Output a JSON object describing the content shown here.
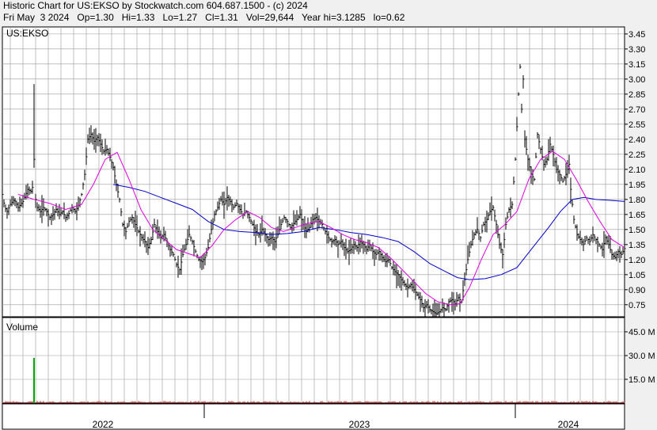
{
  "header": {
    "line1": "Historic Chart for US:EKSO by Stockwatch.com 604.687.1500 - (c) 2024",
    "line2": "Fri May  3 2024   Op=1.30   Hi=1.33   Lo=1.27   Cl=1.31   Vol=29,644   Year hi=3.1285   lo=0.62"
  },
  "chart_data": {
    "type": "line",
    "symbol": "US:EKSO",
    "volume_label": "Volume",
    "price_axis": {
      "ticks": [
        3.45,
        3.3,
        3.15,
        3.0,
        2.85,
        2.7,
        2.55,
        2.4,
        2.25,
        2.1,
        1.95,
        1.8,
        1.65,
        1.5,
        1.35,
        1.2,
        1.05,
        0.9,
        0.75
      ],
      "range": [
        0.63,
        3.52
      ]
    },
    "volume_axis": {
      "ticks": [
        "45.0 M",
        "30.0 M",
        "15.0 M"
      ],
      "tick_values": [
        45,
        30,
        15
      ],
      "range": [
        0,
        54
      ]
    },
    "x_labels": [
      "2022",
      "2023",
      "2024"
    ],
    "colors": {
      "price_bars": "#000000",
      "ma_short": "#e000e0",
      "ma_long": "#0000cc",
      "volume_bars": "#b00000",
      "volume_spike": "#00aa00",
      "grid": "#9a9a9a",
      "background": "#ffffff"
    },
    "series": [
      {
        "key": "price_close",
        "points": [
          [
            0,
            1.85
          ],
          [
            3,
            1.72
          ],
          [
            6,
            1.68
          ],
          [
            10,
            1.75
          ],
          [
            15,
            1.8
          ],
          [
            20,
            1.72
          ],
          [
            26,
            1.78
          ],
          [
            32,
            1.9
          ],
          [
            36,
            1.88
          ],
          [
            38,
            1.92
          ],
          [
            40,
            2.2
          ],
          [
            42,
            1.8
          ],
          [
            44,
            1.72
          ],
          [
            48,
            1.68
          ],
          [
            52,
            1.72
          ],
          [
            56,
            1.68
          ],
          [
            60,
            1.62
          ],
          [
            64,
            1.65
          ],
          [
            68,
            1.7
          ],
          [
            72,
            1.65
          ],
          [
            76,
            1.68
          ],
          [
            80,
            1.62
          ],
          [
            84,
            1.66
          ],
          [
            88,
            1.72
          ],
          [
            92,
            1.68
          ],
          [
            96,
            1.74
          ],
          [
            100,
            1.85
          ],
          [
            104,
            2.05
          ],
          [
            108,
            2.4
          ],
          [
            112,
            2.45
          ],
          [
            116,
            2.38
          ],
          [
            120,
            2.42
          ],
          [
            124,
            2.35
          ],
          [
            128,
            2.28
          ],
          [
            132,
            2.3
          ],
          [
            136,
            2.22
          ],
          [
            140,
            2.12
          ],
          [
            144,
            1.95
          ],
          [
            148,
            1.8
          ],
          [
            152,
            1.55
          ],
          [
            156,
            1.48
          ],
          [
            160,
            1.58
          ],
          [
            164,
            1.62
          ],
          [
            168,
            1.55
          ],
          [
            172,
            1.48
          ],
          [
            176,
            1.42
          ],
          [
            180,
            1.38
          ],
          [
            184,
            1.32
          ],
          [
            188,
            1.4
          ],
          [
            192,
            1.55
          ],
          [
            196,
            1.48
          ],
          [
            200,
            1.42
          ],
          [
            204,
            1.45
          ],
          [
            208,
            1.38
          ],
          [
            212,
            1.3
          ],
          [
            216,
            1.25
          ],
          [
            220,
            1.15
          ],
          [
            224,
            1.1
          ],
          [
            228,
            1.25
          ],
          [
            232,
            1.35
          ],
          [
            236,
            1.45
          ],
          [
            240,
            1.38
          ],
          [
            244,
            1.28
          ],
          [
            248,
            1.2
          ],
          [
            252,
            1.18
          ],
          [
            256,
            1.22
          ],
          [
            260,
            1.32
          ],
          [
            264,
            1.5
          ],
          [
            268,
            1.65
          ],
          [
            272,
            1.72
          ],
          [
            276,
            1.8
          ],
          [
            280,
            1.75
          ],
          [
            284,
            1.82
          ],
          [
            288,
            1.78
          ],
          [
            292,
            1.72
          ],
          [
            296,
            1.76
          ],
          [
            300,
            1.7
          ],
          [
            304,
            1.65
          ],
          [
            308,
            1.68
          ],
          [
            312,
            1.62
          ],
          [
            316,
            1.55
          ],
          [
            320,
            1.48
          ],
          [
            324,
            1.45
          ],
          [
            328,
            1.5
          ],
          [
            332,
            1.45
          ],
          [
            336,
            1.4
          ],
          [
            340,
            1.42
          ],
          [
            344,
            1.38
          ],
          [
            348,
            1.45
          ],
          [
            352,
            1.55
          ],
          [
            356,
            1.62
          ],
          [
            360,
            1.58
          ],
          [
            364,
            1.52
          ],
          [
            368,
            1.56
          ],
          [
            372,
            1.6
          ],
          [
            376,
            1.65
          ],
          [
            380,
            1.55
          ],
          [
            384,
            1.48
          ],
          [
            388,
            1.52
          ],
          [
            392,
            1.6
          ],
          [
            396,
            1.62
          ],
          [
            400,
            1.58
          ],
          [
            404,
            1.55
          ],
          [
            408,
            1.48
          ],
          [
            412,
            1.42
          ],
          [
            416,
            1.38
          ],
          [
            420,
            1.4
          ],
          [
            424,
            1.35
          ],
          [
            428,
            1.38
          ],
          [
            432,
            1.32
          ],
          [
            436,
            1.28
          ],
          [
            440,
            1.3
          ],
          [
            444,
            1.35
          ],
          [
            448,
            1.32
          ],
          [
            452,
            1.38
          ],
          [
            456,
            1.35
          ],
          [
            460,
            1.3
          ],
          [
            464,
            1.35
          ],
          [
            468,
            1.28
          ],
          [
            472,
            1.25
          ],
          [
            476,
            1.28
          ],
          [
            480,
            1.22
          ],
          [
            484,
            1.18
          ],
          [
            488,
            1.2
          ],
          [
            492,
            1.12
          ],
          [
            496,
            1.08
          ],
          [
            500,
            1.05
          ],
          [
            504,
            1.0
          ],
          [
            508,
            0.95
          ],
          [
            512,
            0.92
          ],
          [
            516,
            0.95
          ],
          [
            520,
            0.9
          ],
          [
            524,
            0.85
          ],
          [
            528,
            0.8
          ],
          [
            532,
            0.72
          ],
          [
            536,
            0.75
          ],
          [
            540,
            0.7
          ],
          [
            544,
            0.68
          ],
          [
            548,
            0.66
          ],
          [
            552,
            0.68
          ],
          [
            556,
            0.72
          ],
          [
            560,
            0.7
          ],
          [
            564,
            0.78
          ],
          [
            568,
            0.8
          ],
          [
            572,
            0.76
          ],
          [
            576,
            0.82
          ],
          [
            580,
            0.78
          ],
          [
            584,
            1.0
          ],
          [
            588,
            1.2
          ],
          [
            592,
            1.35
          ],
          [
            596,
            1.45
          ],
          [
            600,
            1.5
          ],
          [
            604,
            1.42
          ],
          [
            608,
            1.55
          ],
          [
            612,
            1.6
          ],
          [
            616,
            1.68
          ],
          [
            620,
            1.72
          ],
          [
            624,
            1.55
          ],
          [
            628,
            1.35
          ],
          [
            632,
            1.25
          ],
          [
            636,
            1.55
          ],
          [
            640,
            1.7
          ],
          [
            644,
            1.75
          ],
          [
            648,
            2.2
          ],
          [
            652,
            2.85
          ],
          [
            654,
            3.12
          ],
          [
            656,
            2.7
          ],
          [
            658,
            3.0
          ],
          [
            660,
            2.4
          ],
          [
            664,
            2.2
          ],
          [
            668,
            2.05
          ],
          [
            672,
            2.0
          ],
          [
            676,
            2.45
          ],
          [
            680,
            2.3
          ],
          [
            684,
            2.15
          ],
          [
            688,
            2.2
          ],
          [
            692,
            2.35
          ],
          [
            696,
            2.25
          ],
          [
            700,
            2.1
          ],
          [
            704,
            2.05
          ],
          [
            708,
            1.98
          ],
          [
            712,
            2.05
          ],
          [
            716,
            2.15
          ],
          [
            718,
            1.9
          ],
          [
            722,
            1.6
          ],
          [
            726,
            1.45
          ],
          [
            730,
            1.4
          ],
          [
            734,
            1.35
          ],
          [
            738,
            1.42
          ],
          [
            742,
            1.38
          ],
          [
            746,
            1.45
          ],
          [
            750,
            1.4
          ],
          [
            754,
            1.35
          ],
          [
            758,
            1.3
          ],
          [
            762,
            1.42
          ],
          [
            766,
            1.35
          ],
          [
            770,
            1.25
          ],
          [
            774,
            1.22
          ],
          [
            778,
            1.28
          ],
          [
            782,
            1.25
          ],
          [
            786,
            1.31
          ]
        ]
      },
      {
        "key": "ma_short",
        "points": [
          [
            20,
            1.85
          ],
          [
            40,
            1.8
          ],
          [
            60,
            1.76
          ],
          [
            80,
            1.7
          ],
          [
            100,
            1.75
          ],
          [
            115,
            1.95
          ],
          [
            130,
            2.2
          ],
          [
            145,
            2.27
          ],
          [
            160,
            2.0
          ],
          [
            175,
            1.7
          ],
          [
            190,
            1.5
          ],
          [
            205,
            1.4
          ],
          [
            220,
            1.3
          ],
          [
            235,
            1.26
          ],
          [
            250,
            1.22
          ],
          [
            265,
            1.34
          ],
          [
            280,
            1.5
          ],
          [
            295,
            1.6
          ],
          [
            310,
            1.68
          ],
          [
            325,
            1.62
          ],
          [
            340,
            1.52
          ],
          [
            355,
            1.48
          ],
          [
            370,
            1.52
          ],
          [
            385,
            1.56
          ],
          [
            400,
            1.58
          ],
          [
            415,
            1.52
          ],
          [
            430,
            1.45
          ],
          [
            445,
            1.4
          ],
          [
            460,
            1.37
          ],
          [
            475,
            1.32
          ],
          [
            490,
            1.22
          ],
          [
            505,
            1.1
          ],
          [
            520,
            0.98
          ],
          [
            535,
            0.86
          ],
          [
            550,
            0.78
          ],
          [
            565,
            0.75
          ],
          [
            578,
            0.76
          ],
          [
            590,
            0.92
          ],
          [
            605,
            1.2
          ],
          [
            620,
            1.45
          ],
          [
            635,
            1.55
          ],
          [
            650,
            1.68
          ],
          [
            665,
            2.0
          ],
          [
            680,
            2.2
          ],
          [
            695,
            2.28
          ],
          [
            710,
            2.2
          ],
          [
            725,
            2.0
          ],
          [
            740,
            1.78
          ],
          [
            755,
            1.58
          ],
          [
            770,
            1.4
          ],
          [
            786,
            1.32
          ]
        ]
      },
      {
        "key": "ma_long",
        "points": [
          [
            140,
            1.95
          ],
          [
            160,
            1.92
          ],
          [
            180,
            1.88
          ],
          [
            200,
            1.82
          ],
          [
            220,
            1.76
          ],
          [
            240,
            1.7
          ],
          [
            260,
            1.58
          ],
          [
            280,
            1.5
          ],
          [
            300,
            1.48
          ],
          [
            320,
            1.47
          ],
          [
            340,
            1.45
          ],
          [
            360,
            1.46
          ],
          [
            380,
            1.48
          ],
          [
            400,
            1.52
          ],
          [
            420,
            1.5
          ],
          [
            440,
            1.47
          ],
          [
            460,
            1.45
          ],
          [
            480,
            1.42
          ],
          [
            500,
            1.38
          ],
          [
            520,
            1.28
          ],
          [
            540,
            1.16
          ],
          [
            560,
            1.08
          ],
          [
            575,
            1.02
          ],
          [
            590,
            1.0
          ],
          [
            610,
            1.01
          ],
          [
            630,
            1.05
          ],
          [
            650,
            1.12
          ],
          [
            670,
            1.32
          ],
          [
            690,
            1.52
          ],
          [
            705,
            1.68
          ],
          [
            720,
            1.8
          ],
          [
            735,
            1.82
          ],
          [
            750,
            1.8
          ],
          [
            770,
            1.79
          ],
          [
            786,
            1.78
          ]
        ]
      },
      {
        "key": "volume",
        "points": [
          [
            40,
            28.5
          ]
        ]
      }
    ]
  }
}
